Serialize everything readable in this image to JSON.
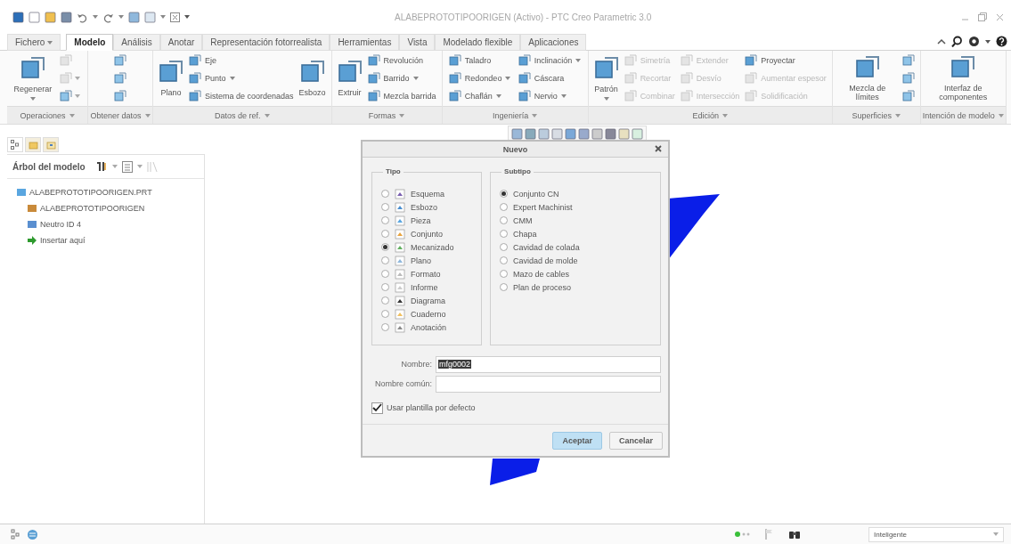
{
  "window": {
    "title": "ALABEPROTOTIPOORIGEN (Activo) - PTC Creo Parametric 3.0"
  },
  "tabs": [
    {
      "label": "Fichero",
      "selected": false,
      "dropdown": true
    },
    {
      "label": "Modelo",
      "selected": true,
      "dropdown": false
    },
    {
      "label": "Análisis",
      "selected": false,
      "dropdown": false
    },
    {
      "label": "Anotar",
      "selected": false,
      "dropdown": false
    },
    {
      "label": "Representación fotorrealista",
      "selected": false,
      "dropdown": false
    },
    {
      "label": "Herramientas",
      "selected": false,
      "dropdown": false
    },
    {
      "label": "Vista",
      "selected": false,
      "dropdown": false
    },
    {
      "label": "Modelado flexible",
      "selected": false,
      "dropdown": false
    },
    {
      "label": "Aplicaciones",
      "selected": false,
      "dropdown": false
    }
  ],
  "ribbon": {
    "groups": [
      {
        "label": "Operaciones",
        "columns": [
          [
            {
              "kind": "large",
              "label": "Regenerar",
              "dropdown": true,
              "disabled": false
            }
          ],
          [
            {
              "kind": "icon",
              "dropdown": false,
              "disabled": true
            },
            {
              "kind": "icon",
              "dropdown": true,
              "disabled": true
            },
            {
              "kind": "icon",
              "dropdown": true,
              "disabled": false
            }
          ]
        ]
      },
      {
        "label": "Obtener datos",
        "columns": [
          [
            {
              "kind": "icon",
              "dropdown": false,
              "disabled": false
            },
            {
              "kind": "icon",
              "dropdown": false,
              "disabled": false
            },
            {
              "kind": "icon",
              "dropdown": false,
              "disabled": false
            }
          ]
        ]
      },
      {
        "label": "Datos de ref.",
        "columns": [
          [
            {
              "kind": "large",
              "label": "Plano",
              "dropdown": false,
              "disabled": false
            }
          ],
          [
            {
              "kind": "small",
              "label": "Eje",
              "dropdown": false,
              "disabled": false
            },
            {
              "kind": "small",
              "label": "Punto",
              "dropdown": true,
              "disabled": false
            },
            {
              "kind": "small",
              "label": "Sistema de coordenadas",
              "dropdown": false,
              "disabled": false
            }
          ],
          [
            {
              "kind": "large",
              "label": "Esbozo",
              "dropdown": false,
              "disabled": false
            }
          ]
        ]
      },
      {
        "label": "Formas",
        "columns": [
          [
            {
              "kind": "large",
              "label": "Extruir",
              "dropdown": false,
              "disabled": false
            }
          ],
          [
            {
              "kind": "small",
              "label": "Revolución",
              "dropdown": false,
              "disabled": false
            },
            {
              "kind": "small",
              "label": "Barrido",
              "dropdown": true,
              "disabled": false
            },
            {
              "kind": "small",
              "label": "Mezcla barrida",
              "dropdown": false,
              "disabled": false
            }
          ]
        ]
      },
      {
        "label": "Ingeniería",
        "columns": [
          [
            {
              "kind": "small",
              "label": "Taladro",
              "dropdown": false,
              "disabled": false
            },
            {
              "kind": "small",
              "label": "Redondeo",
              "dropdown": true,
              "disabled": false
            },
            {
              "kind": "small",
              "label": "Chaflán",
              "dropdown": true,
              "disabled": false
            }
          ],
          [
            {
              "kind": "small",
              "label": "Inclinación",
              "dropdown": true,
              "disabled": false
            },
            {
              "kind": "small",
              "label": "Cáscara",
              "dropdown": false,
              "disabled": false
            },
            {
              "kind": "small",
              "label": "Nervio",
              "dropdown": true,
              "disabled": false
            }
          ]
        ]
      },
      {
        "label": "Edición",
        "columns": [
          [
            {
              "kind": "large",
              "label": "Patrón",
              "dropdown": true,
              "disabled": false
            }
          ],
          [
            {
              "kind": "small",
              "label": "Simetría",
              "dropdown": false,
              "disabled": true
            },
            {
              "kind": "small",
              "label": "Recortar",
              "dropdown": false,
              "disabled": true
            },
            {
              "kind": "small",
              "label": "Combinar",
              "dropdown": false,
              "disabled": true
            }
          ],
          [
            {
              "kind": "small",
              "label": "Extender",
              "dropdown": false,
              "disabled": true
            },
            {
              "kind": "small",
              "label": "Desvío",
              "dropdown": false,
              "disabled": true
            },
            {
              "kind": "small",
              "label": "Intersección",
              "dropdown": false,
              "disabled": true
            }
          ],
          [
            {
              "kind": "small",
              "label": "Proyectar",
              "dropdown": false,
              "disabled": false
            },
            {
              "kind": "small",
              "label": "Aumentar espesor",
              "dropdown": false,
              "disabled": true
            },
            {
              "kind": "small",
              "label": "Solidificación",
              "dropdown": false,
              "disabled": true
            }
          ]
        ]
      },
      {
        "label": "Superficies",
        "columns": [
          [
            {
              "kind": "large",
              "label": "Mezcla de límites",
              "dropdown": false,
              "disabled": false
            }
          ],
          [
            {
              "kind": "icon",
              "dropdown": false,
              "disabled": false
            },
            {
              "kind": "icon",
              "dropdown": false,
              "disabled": false
            },
            {
              "kind": "icon",
              "dropdown": false,
              "disabled": false
            }
          ]
        ]
      },
      {
        "label": "Intención de modelo",
        "columns": [
          [
            {
              "kind": "large",
              "label": "Interfaz de componentes",
              "dropdown": false,
              "disabled": false
            }
          ]
        ]
      }
    ]
  },
  "model_tree": {
    "nav_tabs": [
      {
        "selected": true
      },
      {
        "selected": false
      },
      {
        "selected": false
      }
    ],
    "title": "Árbol del modelo",
    "items": [
      {
        "label": "ALABEPROTOTIPOORIGEN.PRT",
        "kind": "part",
        "children": [
          {
            "label": "ALABEPROTOTIPOORIGEN",
            "kind": "csys"
          },
          {
            "label": "Neutro ID 4",
            "kind": "layer"
          },
          {
            "label": "Insertar aquí",
            "kind": "insert"
          }
        ]
      }
    ]
  },
  "dialog": {
    "title": "Nuevo",
    "type_group": {
      "title": "Tipo",
      "options": [
        {
          "label": "Esquema",
          "kind": "layout",
          "selected": false
        },
        {
          "label": "Esbozo",
          "kind": "sketch",
          "selected": false
        },
        {
          "label": "Pieza",
          "kind": "part",
          "selected": false
        },
        {
          "label": "Conjunto",
          "kind": "assembly",
          "selected": false
        },
        {
          "label": "Mecanizado",
          "kind": "manufacturing",
          "selected": true
        },
        {
          "label": "Plano",
          "kind": "drawing",
          "selected": false
        },
        {
          "label": "Formato",
          "kind": "format",
          "selected": false
        },
        {
          "label": "Informe",
          "kind": "report",
          "selected": false
        },
        {
          "label": "Diagrama",
          "kind": "diagram",
          "selected": false
        },
        {
          "label": "Cuaderno",
          "kind": "notebook",
          "selected": false
        },
        {
          "label": "Anotación",
          "kind": "markup",
          "selected": false
        }
      ]
    },
    "subtype_group": {
      "title": "Subtipo",
      "options": [
        {
          "label": "Conjunto CN",
          "selected": true
        },
        {
          "label": "Expert Machinist",
          "selected": false
        },
        {
          "label": "CMM",
          "selected": false
        },
        {
          "label": "Chapa",
          "selected": false
        },
        {
          "label": "Cavidad de colada",
          "selected": false
        },
        {
          "label": "Cavidad de molde",
          "selected": false
        },
        {
          "label": "Mazo de cables",
          "selected": false
        },
        {
          "label": "Plan de proceso",
          "selected": false
        }
      ]
    },
    "name_field": {
      "label": "Nombre:",
      "value": "mfg0002",
      "selected": true
    },
    "common_name_field": {
      "label": "Nombre común:"
    },
    "template_checkbox": {
      "label": "Usar plantilla por defecto",
      "checked": true
    },
    "buttons": [
      {
        "label": "Aceptar",
        "kind": "primary"
      },
      {
        "label": "Cancelar",
        "kind": "secondary"
      }
    ]
  },
  "status_bar": {
    "filter": {
      "value": "Inteligente"
    }
  }
}
